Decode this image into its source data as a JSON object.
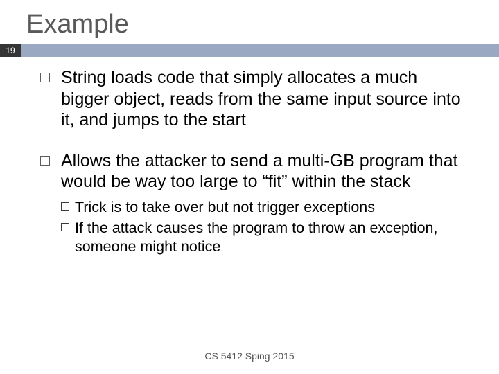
{
  "title": "Example",
  "slide_number": "19",
  "bullets": [
    "String loads code that simply allocates a much bigger object, reads from the same input source into it, and jumps to the start",
    "Allows the attacker to send a multi-GB program that would be way too large to “fit” within the stack"
  ],
  "sub_bullets": [
    "Trick is to take over but not trigger exceptions",
    "If the attack causes the program to throw an exception, someone might notice"
  ],
  "footer": "CS 5412 Sping 2015"
}
